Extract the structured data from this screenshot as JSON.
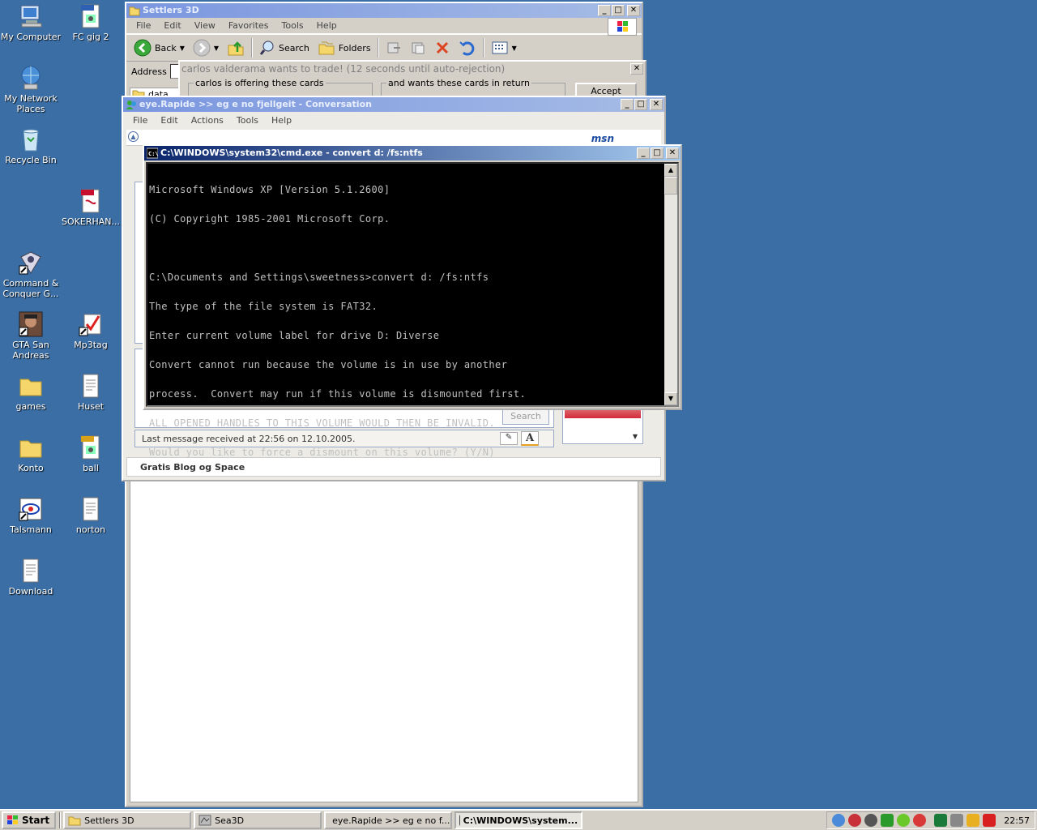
{
  "desktop": {
    "icons": [
      {
        "label": "My Computer"
      },
      {
        "label": "FC gig 2"
      },
      {
        "label": "My Network Places"
      },
      {
        "label": "Recycle Bin"
      },
      {
        "label": "SOKERHAN..."
      },
      {
        "label": "Command & Conquer G..."
      },
      {
        "label": "GTA San Andreas"
      },
      {
        "label": "Mp3tag"
      },
      {
        "label": "games"
      },
      {
        "label": "Huset"
      },
      {
        "label": "Konto"
      },
      {
        "label": "ball"
      },
      {
        "label": "Talsmann"
      },
      {
        "label": "norton"
      },
      {
        "label": "Download"
      }
    ]
  },
  "explorer": {
    "title": "Settlers 3D",
    "menu": [
      "File",
      "Edit",
      "View",
      "Favorites",
      "Tools",
      "Help"
    ],
    "toolbar": {
      "back": "Back",
      "search": "Search",
      "folders": "Folders"
    },
    "address_label": "Address",
    "folder_item": "data"
  },
  "trade": {
    "title": "carlos valderama wants to trade! (12 seconds until auto-rejection)",
    "offering": "carlos is offering these cards",
    "wants": "and wants these cards in return",
    "accept": "Accept"
  },
  "msn": {
    "title": "eye.Rapide >> eg e no fjellgeit - Conversation",
    "menu": [
      "File",
      "Edit",
      "Actions",
      "Tools",
      "Help"
    ],
    "logo": "msn",
    "search": "Search",
    "status": "Last message received at 22:56 on 12.10.2005.",
    "font_button": "A",
    "ad": "Gratis Blog og Space"
  },
  "cmd": {
    "title": "C:\\WINDOWS\\system32\\cmd.exe - convert d: /fs:ntfs",
    "lines": [
      "Microsoft Windows XP [Version 5.1.2600]",
      "(C) Copyright 1985-2001 Microsoft Corp.",
      "",
      "C:\\Documents and Settings\\sweetness>convert d: /fs:ntfs",
      "The type of the file system is FAT32.",
      "Enter current volume label for drive D: Diverse",
      "Convert cannot run because the volume is in use by another",
      "process.  Convert may run if this volume is dismounted first.",
      "ALL OPENED HANDLES TO THIS VOLUME WOULD THEN BE INVALID.",
      "Would you like to force a dismount on this volume? (Y/N)"
    ]
  },
  "taskbar": {
    "start": "Start",
    "tasks": [
      {
        "label": "Settlers 3D"
      },
      {
        "label": "Sea3D"
      },
      {
        "label": "eye.Rapide >> eg e no f..."
      },
      {
        "label": "C:\\WINDOWS\\system..."
      }
    ],
    "clock": "22:57"
  },
  "colors": {
    "desktop": "#3a6ea5",
    "title_active": "#0a246a",
    "title_inactive": "#808080"
  }
}
